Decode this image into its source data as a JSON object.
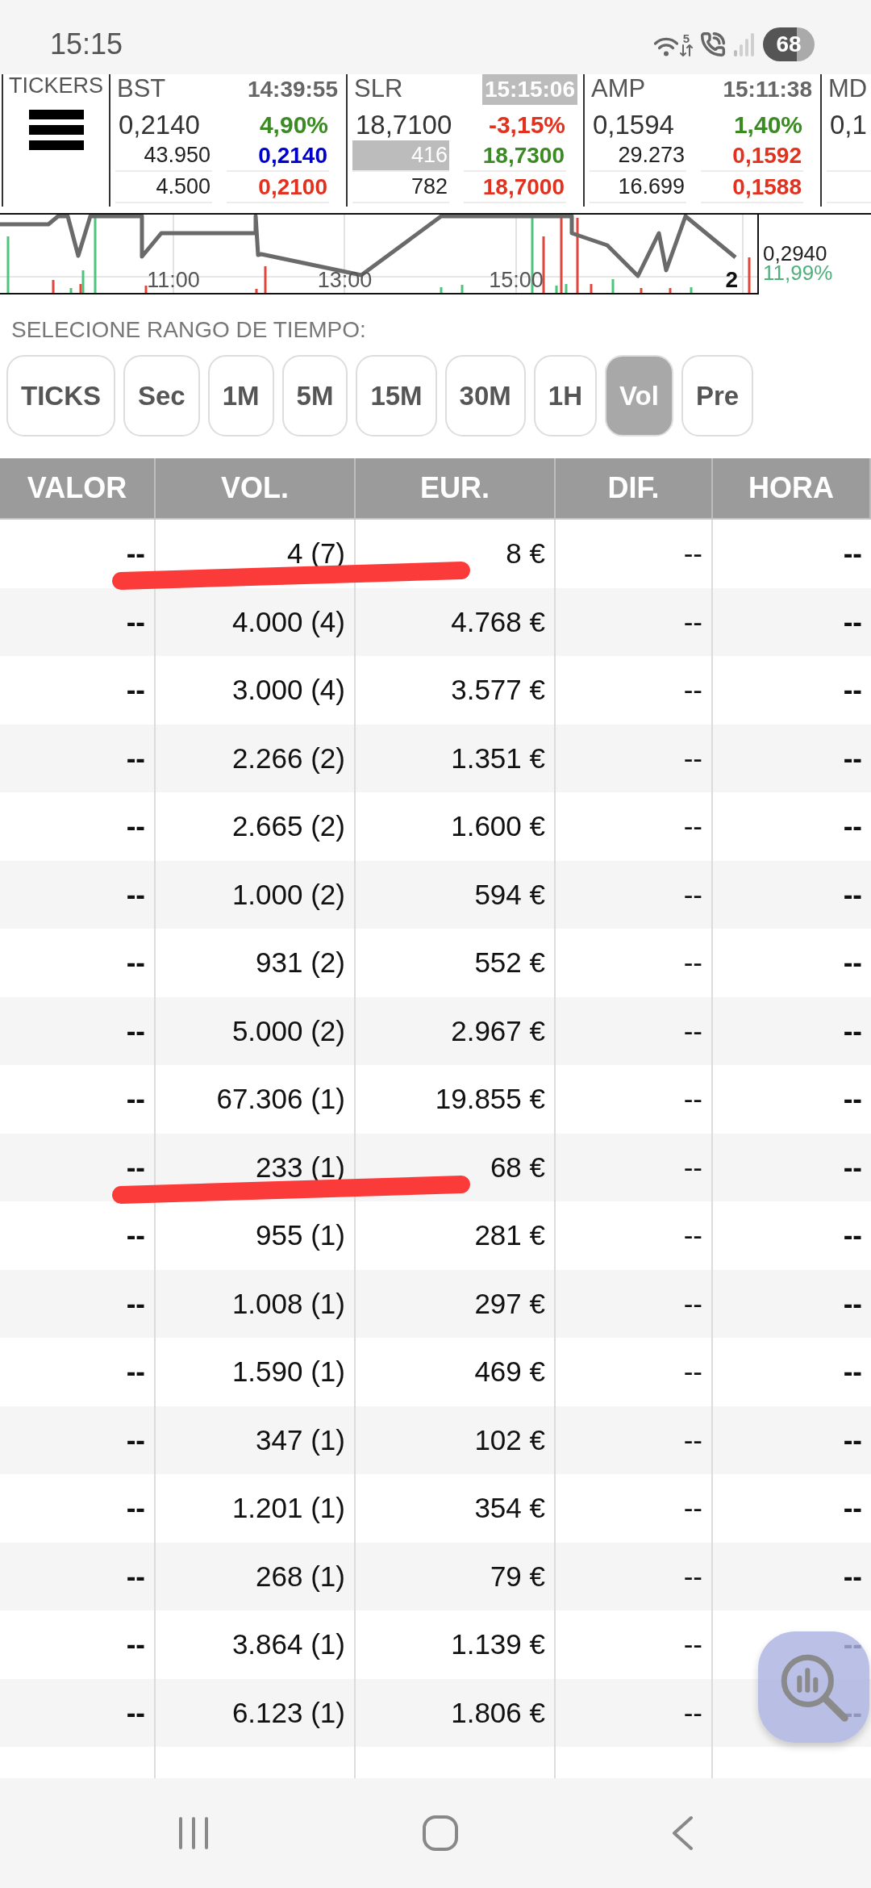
{
  "status_bar": {
    "time": "15:15",
    "network_label": "5",
    "battery": "68"
  },
  "tickers_panel": {
    "title": "TICKERS"
  },
  "tickers": [
    {
      "symbol": "BST",
      "time": "14:39:55",
      "time_highlighted": false,
      "price": "0,2140",
      "change": "4,90%",
      "change_rising": true,
      "quotes": [
        {
          "volume": "43.950",
          "volume_highlighted": false,
          "price": "0,2140",
          "color": "#0000cc"
        },
        {
          "volume": "4.500",
          "volume_highlighted": false,
          "price": "0,2100",
          "color": "#e2321f"
        }
      ]
    },
    {
      "symbol": "SLR",
      "time": "15:15:06",
      "time_highlighted": true,
      "price": "18,7100",
      "change": "-3,15%",
      "change_rising": false,
      "quotes": [
        {
          "volume": "416",
          "volume_highlighted": true,
          "price": "18,7300",
          "color": "#3b8a23"
        },
        {
          "volume": "782",
          "volume_highlighted": false,
          "price": "18,7000",
          "color": "#e2321f"
        }
      ]
    },
    {
      "symbol": "AMP",
      "time": "15:11:38",
      "time_highlighted": false,
      "price": "0,1594",
      "change": "1,40%",
      "change_rising": true,
      "quotes": [
        {
          "volume": "29.273",
          "volume_highlighted": false,
          "price": "0,1592",
          "color": "#e2321f"
        },
        {
          "volume": "16.699",
          "volume_highlighted": false,
          "price": "0,1588",
          "color": "#e2321f"
        }
      ]
    },
    {
      "symbol": "MD",
      "price": "0,1"
    }
  ],
  "chart": {
    "time_labels": [
      "11:00",
      "13:00",
      "15:00"
    ],
    "corner_label": "2",
    "last_price": "0,2940",
    "change": "11,99%",
    "change_rising": true
  },
  "range": {
    "label": "SELECIONE RANGO DE TIEMPO:",
    "options": [
      {
        "label": "TICKS",
        "selected": false
      },
      {
        "label": "Sec",
        "selected": false
      },
      {
        "label": "1M",
        "selected": false
      },
      {
        "label": "5M",
        "selected": false
      },
      {
        "label": "15M",
        "selected": false
      },
      {
        "label": "30M",
        "selected": false
      },
      {
        "label": "1H",
        "selected": false
      },
      {
        "label": "Vol",
        "selected": true
      },
      {
        "label": "Pre",
        "selected": false
      }
    ]
  },
  "table": {
    "columns": [
      "VALOR",
      "VOL.",
      "EUR.",
      "DIF.",
      "HORA"
    ],
    "rows": [
      {
        "valor": "--",
        "vol": "4 (7)",
        "eur": "8 €",
        "dif": "--",
        "hora": "--",
        "marked": true
      },
      {
        "valor": "--",
        "vol": "4.000 (4)",
        "eur": "4.768 €",
        "dif": "--",
        "hora": "--",
        "marked": false
      },
      {
        "valor": "--",
        "vol": "3.000 (4)",
        "eur": "3.577 €",
        "dif": "--",
        "hora": "--",
        "marked": false
      },
      {
        "valor": "--",
        "vol": "2.266 (2)",
        "eur": "1.351 €",
        "dif": "--",
        "hora": "--",
        "marked": false
      },
      {
        "valor": "--",
        "vol": "2.665 (2)",
        "eur": "1.600 €",
        "dif": "--",
        "hora": "--",
        "marked": false
      },
      {
        "valor": "--",
        "vol": "1.000 (2)",
        "eur": "594 €",
        "dif": "--",
        "hora": "--",
        "marked": false
      },
      {
        "valor": "--",
        "vol": "931 (2)",
        "eur": "552 €",
        "dif": "--",
        "hora": "--",
        "marked": false
      },
      {
        "valor": "--",
        "vol": "5.000 (2)",
        "eur": "2.967 €",
        "dif": "--",
        "hora": "--",
        "marked": false
      },
      {
        "valor": "--",
        "vol": "67.306 (1)",
        "eur": "19.855 €",
        "dif": "--",
        "hora": "--",
        "marked": false
      },
      {
        "valor": "--",
        "vol": "233 (1)",
        "eur": "68 €",
        "dif": "--",
        "hora": "--",
        "marked": true
      },
      {
        "valor": "--",
        "vol": "955 (1)",
        "eur": "281 €",
        "dif": "--",
        "hora": "--",
        "marked": false
      },
      {
        "valor": "--",
        "vol": "1.008 (1)",
        "eur": "297 €",
        "dif": "--",
        "hora": "--",
        "marked": false
      },
      {
        "valor": "--",
        "vol": "1.590 (1)",
        "eur": "469 €",
        "dif": "--",
        "hora": "--",
        "marked": false
      },
      {
        "valor": "--",
        "vol": "347 (1)",
        "eur": "102 €",
        "dif": "--",
        "hora": "--",
        "marked": false
      },
      {
        "valor": "--",
        "vol": "1.201 (1)",
        "eur": "354 €",
        "dif": "--",
        "hora": "--",
        "marked": false
      },
      {
        "valor": "--",
        "vol": "268 (1)",
        "eur": "79 €",
        "dif": "--",
        "hora": "--",
        "marked": false
      },
      {
        "valor": "--",
        "vol": "3.864 (1)",
        "eur": "1.139 €",
        "dif": "--",
        "hora": "--",
        "marked": false
      },
      {
        "valor": "--",
        "vol": "6.123 (1)",
        "eur": "1.806 €",
        "dif": "--",
        "hora": "--",
        "marked": false
      }
    ]
  }
}
